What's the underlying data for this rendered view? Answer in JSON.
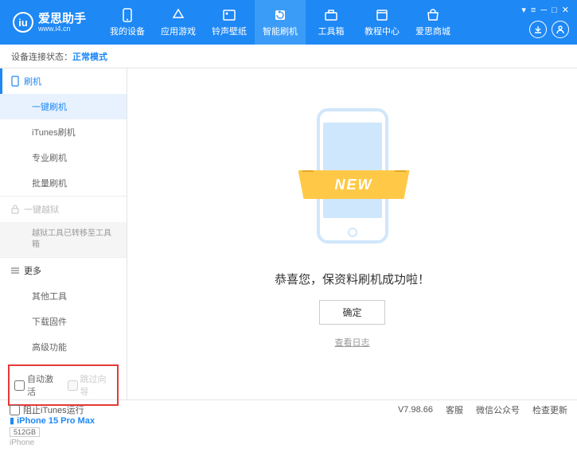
{
  "header": {
    "logo_letter": "iu",
    "title": "爱思助手",
    "subtitle": "www.i4.cn",
    "nav": [
      {
        "label": "我的设备"
      },
      {
        "label": "应用游戏"
      },
      {
        "label": "铃声壁纸"
      },
      {
        "label": "智能刷机"
      },
      {
        "label": "工具箱"
      },
      {
        "label": "教程中心"
      },
      {
        "label": "爱思商城"
      }
    ]
  },
  "status": {
    "label": "设备连接状态：",
    "mode": "正常模式"
  },
  "sidebar": {
    "flash_header": "刷机",
    "flash_items": [
      "一键刷机",
      "iTunes刷机",
      "专业刷机",
      "批量刷机"
    ],
    "jailbreak_header": "一键越狱",
    "jailbreak_note": "越狱工具已转移至工具箱",
    "more_header": "更多",
    "more_items": [
      "其他工具",
      "下载固件",
      "高级功能"
    ],
    "checkbox1": "自动激活",
    "checkbox2": "跳过向导",
    "device": {
      "name": "iPhone 15 Pro Max",
      "storage": "512GB",
      "type": "iPhone"
    }
  },
  "main": {
    "new_label": "NEW",
    "success": "恭喜您，保资料刷机成功啦！",
    "ok": "确定",
    "log": "查看日志"
  },
  "footer": {
    "block_itunes": "阻止iTunes运行",
    "version": "V7.98.66",
    "links": [
      "客服",
      "微信公众号",
      "检查更新"
    ]
  }
}
